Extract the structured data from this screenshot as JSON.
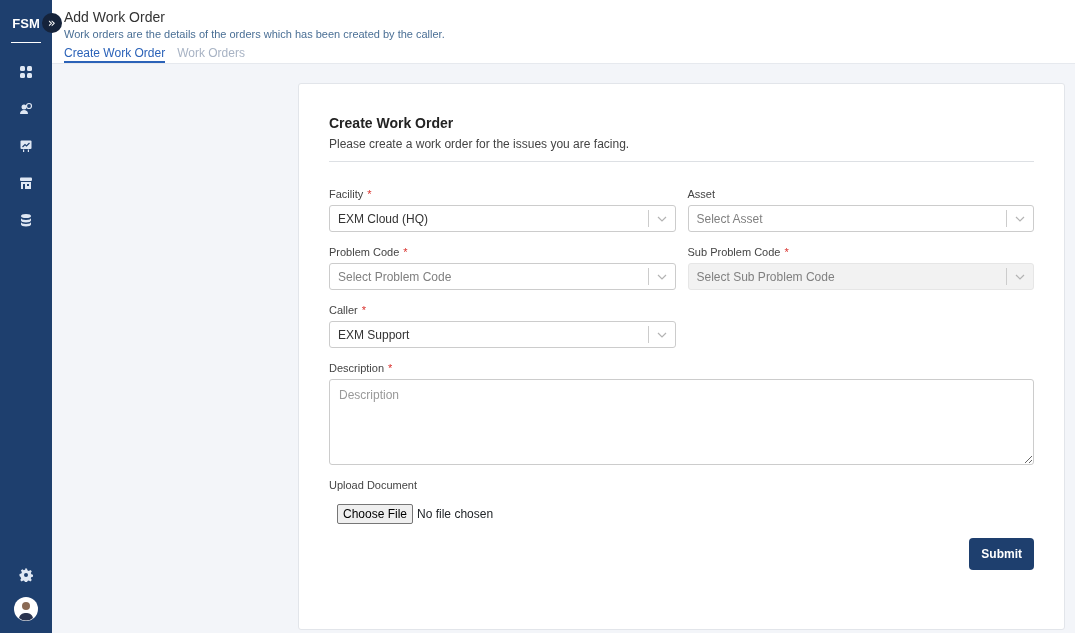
{
  "sidebar": {
    "logo": "FSM",
    "expand_glyph": "»"
  },
  "header": {
    "title": "Add Work Order",
    "subtitle": "Work orders are the details of the orders which has been created by the caller.",
    "tabs": [
      {
        "label": "Create Work Order",
        "selected": true
      },
      {
        "label": "Work Orders",
        "selected": false
      }
    ]
  },
  "form": {
    "title": "Create Work Order",
    "required_mark": "*",
    "subtitle": "Please create a work order for the issues you are facing.",
    "selects": [
      {
        "label": "Facility",
        "required": true,
        "value": "EXM Cloud (HQ)",
        "disabled": false
      },
      {
        "label": "Asset",
        "required": false,
        "placeholder": "Select Asset",
        "disabled": false
      },
      {
        "label": "Problem Code",
        "required": true,
        "placeholder": "Select Problem Code",
        "disabled": false
      },
      {
        "label": "Sub Problem Code",
        "required": true,
        "placeholder": "Select Sub Problem Code",
        "disabled": true
      },
      {
        "label": "Caller",
        "required": true,
        "value": "EXM Support",
        "disabled": false
      }
    ],
    "description": {
      "label": "Description",
      "required": true,
      "placeholder": "Description"
    },
    "upload": {
      "label": "Upload Document",
      "button": "Choose File",
      "status": "No file chosen"
    },
    "submit": "Submit"
  }
}
